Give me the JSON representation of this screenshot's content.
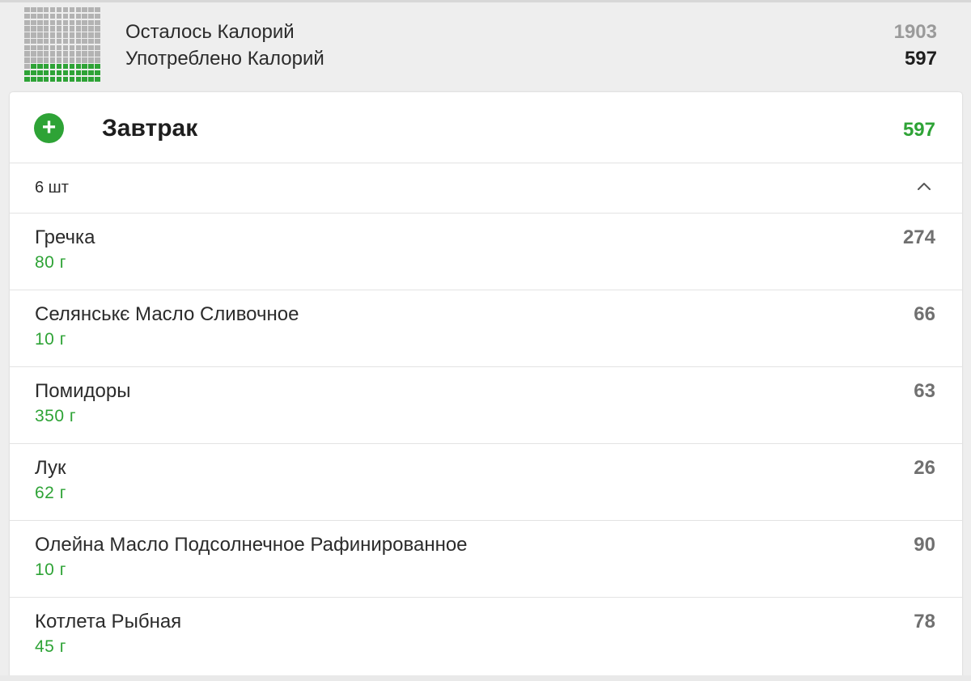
{
  "summary": {
    "remaining_label": "Осталось Калорий",
    "remaining_value": "1903",
    "consumed_label": "Употреблено Калорий",
    "consumed_value": "597",
    "progress_fraction": 0.24,
    "colors": {
      "filled": "#2ea336",
      "empty": "#b3b3b3"
    }
  },
  "meal": {
    "title": "Завтрак",
    "total_kcal": "597",
    "add_icon": "plus-circle-icon",
    "count_label": "6 шт",
    "collapse_icon": "chevron-up-icon",
    "items": [
      {
        "name": "Гречка",
        "amount": "80 г",
        "kcal": "274"
      },
      {
        "name": "Селянськє Масло Сливочное",
        "amount": "10 г",
        "kcal": "66"
      },
      {
        "name": "Помидоры",
        "amount": "350 г",
        "kcal": "63"
      },
      {
        "name": "Лук",
        "amount": "62 г",
        "kcal": "26"
      },
      {
        "name": "Олейна Масло Подсолнечное Рафинированное",
        "amount": "10 г",
        "kcal": "90"
      },
      {
        "name": "Котлета Рыбная",
        "amount": "45 г",
        "kcal": "78"
      }
    ]
  },
  "colors": {
    "accent": "#2ea336",
    "background": "#eeeeee",
    "card": "#ffffff"
  }
}
